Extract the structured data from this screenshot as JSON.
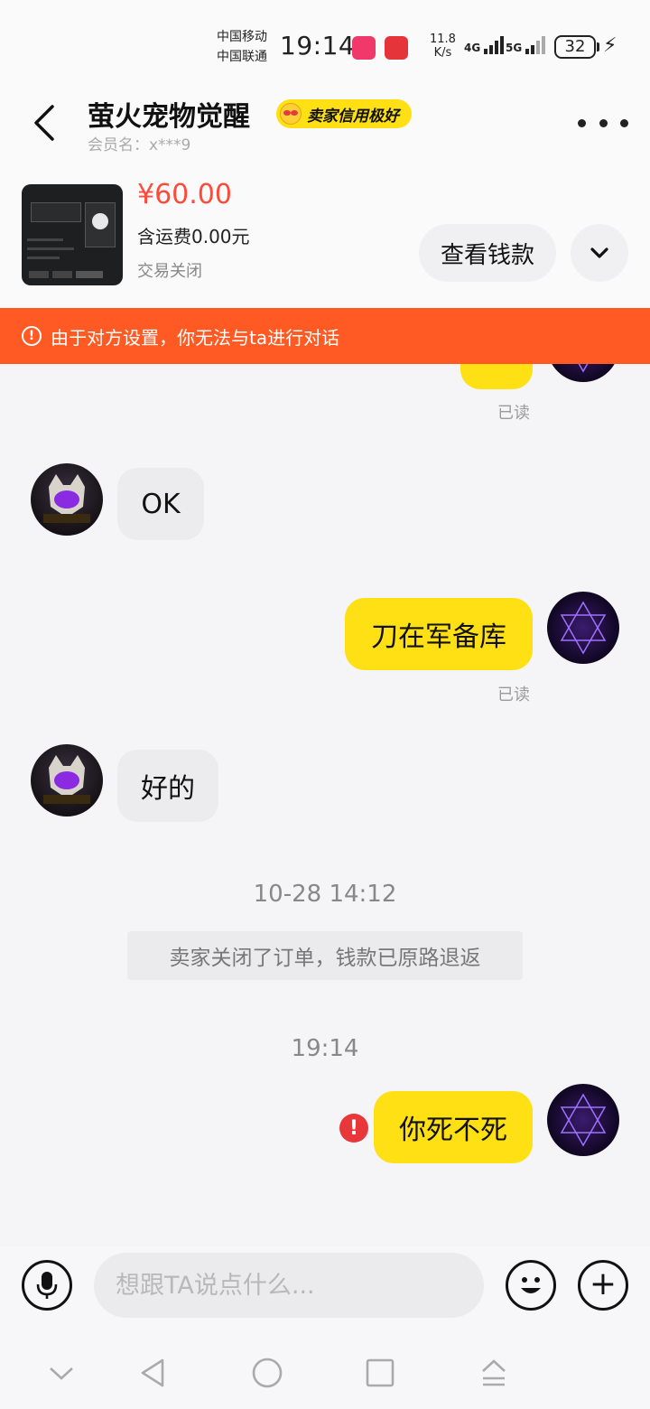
{
  "status_bar": {
    "carrier1": "中国移动",
    "carrier2": "中国联通",
    "time": "19:14",
    "net_speed_value": "11.8",
    "net_speed_unit": "K/s",
    "signal1": "4G",
    "signal2": "5G",
    "battery": "32"
  },
  "header": {
    "title": "萤火宠物觉醒",
    "credit_badge": "卖家信用极好",
    "member": "会员名：x***9"
  },
  "product": {
    "price": "¥60.00",
    "shipping": "含运费0.00元",
    "status": "交易关闭",
    "view_button": "查看钱款"
  },
  "warning": {
    "text": "由于对方设置，你无法与ta进行对话"
  },
  "messages": {
    "m1_read": "已读",
    "m2_text": "OK",
    "m3_text": "刀在军备库",
    "m3_read": "已读",
    "m4_text": "好的",
    "time1": "10-28 14:12",
    "system_msg": "卖家关闭了订单，钱款已原路退返",
    "time2": "19:14",
    "m5_text": "你死不死"
  },
  "input": {
    "placeholder": "想跟TA说点什么..."
  },
  "colors": {
    "accent_yellow": "#ffe014",
    "warning_orange": "#ff5a23",
    "price_red": "#ff4a3a",
    "error_red": "#e8373a"
  }
}
